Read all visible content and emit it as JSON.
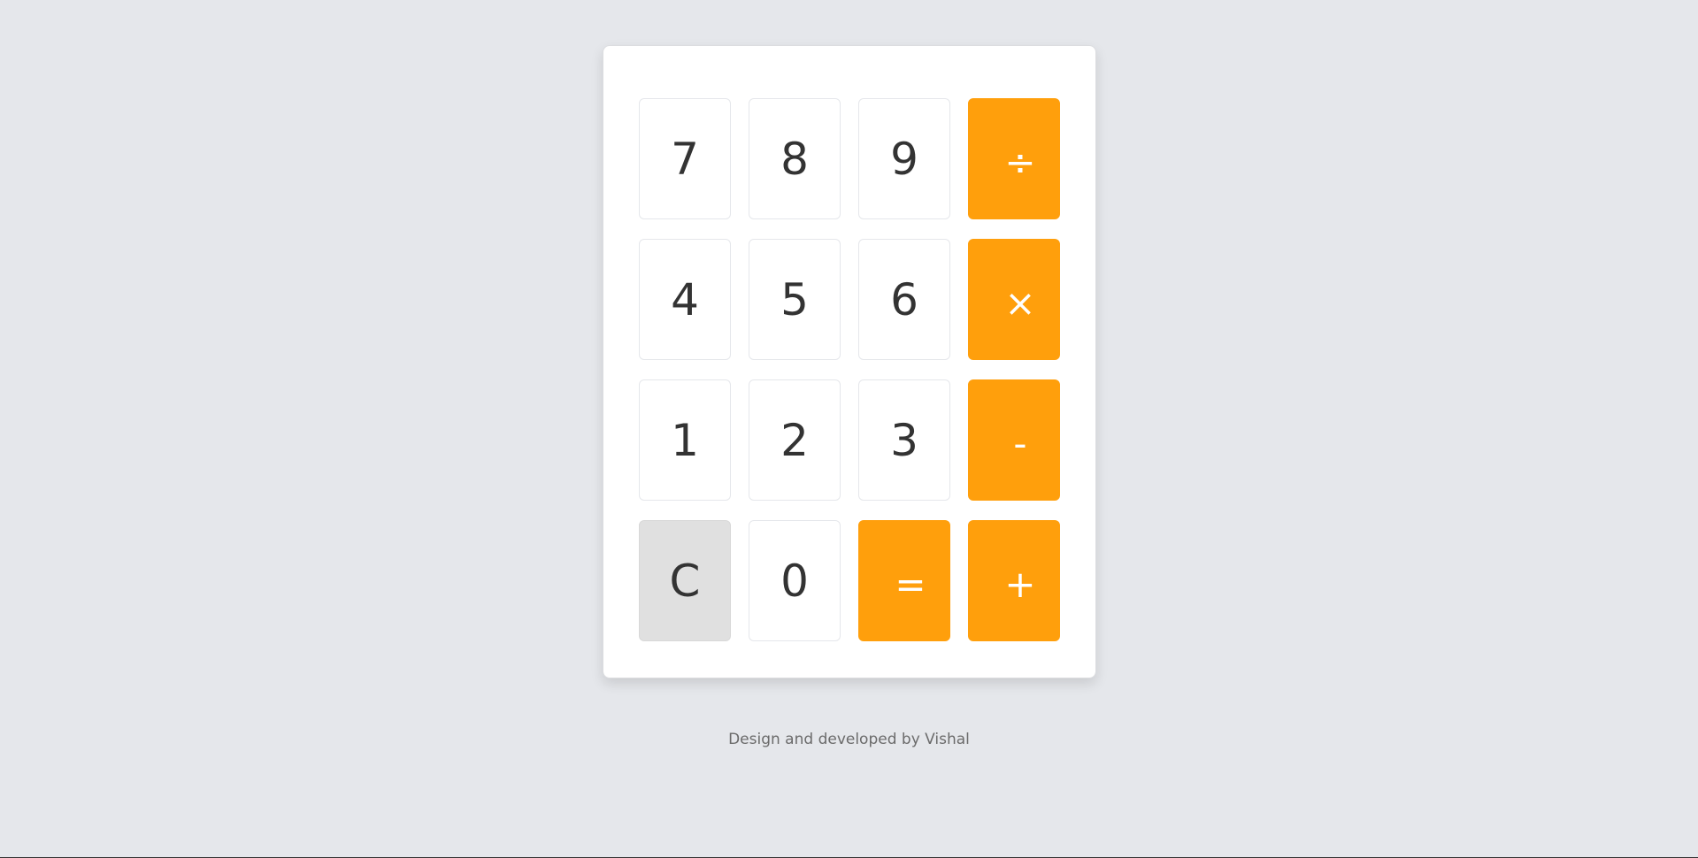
{
  "keypad": {
    "keys": [
      {
        "label": "7",
        "kind": "digit"
      },
      {
        "label": "8",
        "kind": "digit"
      },
      {
        "label": "9",
        "kind": "digit"
      },
      {
        "label": "÷",
        "kind": "operator"
      },
      {
        "label": "4",
        "kind": "digit"
      },
      {
        "label": "5",
        "kind": "digit"
      },
      {
        "label": "6",
        "kind": "digit"
      },
      {
        "label": "×",
        "kind": "operator"
      },
      {
        "label": "1",
        "kind": "digit"
      },
      {
        "label": "2",
        "kind": "digit"
      },
      {
        "label": "3",
        "kind": "digit"
      },
      {
        "label": "-",
        "kind": "operator"
      },
      {
        "label": "C",
        "kind": "clear"
      },
      {
        "label": "0",
        "kind": "digit"
      },
      {
        "label": "=",
        "kind": "operator"
      },
      {
        "label": "+",
        "kind": "operator"
      }
    ]
  },
  "footer": {
    "credit": "Design and developed by Vishal"
  },
  "colors": {
    "page_background": "#e5e7eb",
    "operator_accent": "#ff9f0c",
    "clear_key_background": "#e0e0e0",
    "digit_text": "#333333"
  }
}
